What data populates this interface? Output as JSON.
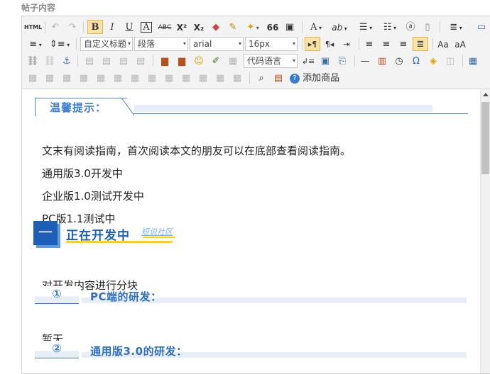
{
  "field_label": "帖子内容",
  "toolbar": {
    "row1": {
      "html": "HTML",
      "bold": "B",
      "italic": "I",
      "underline": "U",
      "fontborder": "A",
      "strike": "ABC",
      "superscript": "X²",
      "subscript": "X₂",
      "quote": "66",
      "forecolor": "A",
      "backcolor": "ab"
    },
    "row2": {
      "custom_title": "自定义标题",
      "paragraph": "段落",
      "font_family": "arial",
      "font_size": "16px",
      "code_language": "代码语言"
    },
    "row4": {
      "add_goods": "添加商品"
    }
  },
  "content": {
    "tip_title": "温馨提示：",
    "intro": "文末有阅读指南，首次阅读本文的朋友可以在底部查看阅读指南。",
    "line1": "通用版3.0开发中",
    "line2": "企业版1.0测试开发中",
    "line3": "PC版1.1测试中",
    "section1_num": "一",
    "section1_title": "正在开发中",
    "section1_tag": "短说社区",
    "section1_desc": "对开发内容进行分块",
    "sub1_num": "①",
    "sub1_title": "PC端的研发：",
    "sub1_body": "暂无",
    "sub2_num": "②",
    "sub2_title": "通用版3.0的研发："
  },
  "colors": {
    "accent_blue": "#1d5fb7",
    "highlight_yellow": "#ffd200",
    "toolbar_bg": "#f3f3f3"
  }
}
